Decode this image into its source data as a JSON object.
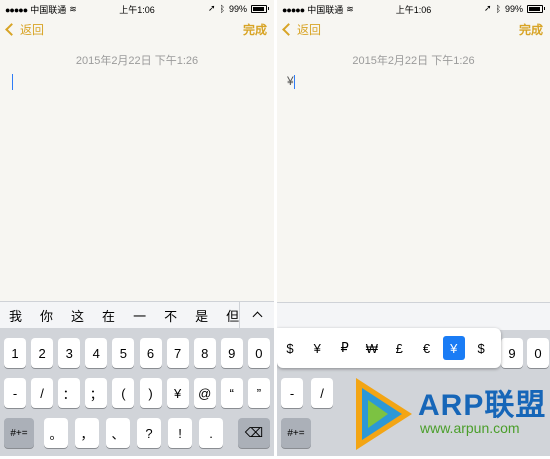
{
  "left": {
    "status": {
      "signal": "●●●●●",
      "carrier": "中国联通",
      "time": "上午1:06",
      "battery": "99%"
    },
    "nav": {
      "back": "返回",
      "done": "完成"
    },
    "date": "2015年2月22日 下午1:26",
    "suggestions": [
      "我",
      "你",
      "这",
      "在",
      "一",
      "不",
      "是",
      "但"
    ],
    "keys": {
      "row1": [
        "1",
        "2",
        "3",
        "4",
        "5",
        "6",
        "7",
        "8",
        "9",
        "0"
      ],
      "row2": [
        "-",
        "/",
        "：",
        "；",
        "(",
        ")",
        "¥",
        "@",
        "“",
        "”"
      ],
      "row3": [
        "#+=",
        "。",
        "，",
        "、",
        "?",
        "!",
        ".",
        "⌫"
      ]
    }
  },
  "right": {
    "status": {
      "signal": "●●●●●",
      "carrier": "中国联通",
      "time": "上午1:06",
      "battery": "99%"
    },
    "nav": {
      "back": "返回",
      "done": "完成"
    },
    "date": "2015年2月22日 下午1:26",
    "typed": "¥",
    "currency_options": [
      "$",
      "¥",
      "₽",
      "₩",
      "£",
      "€",
      "¥",
      "$"
    ],
    "selected_index": 6,
    "visible_keys": {
      "row1": [
        "9",
        "0"
      ],
      "row2": [
        "-",
        "/"
      ],
      "row3": [
        "#+="
      ]
    }
  },
  "watermark": {
    "brand": "ARP联盟",
    "url": "www.arpun.com"
  }
}
